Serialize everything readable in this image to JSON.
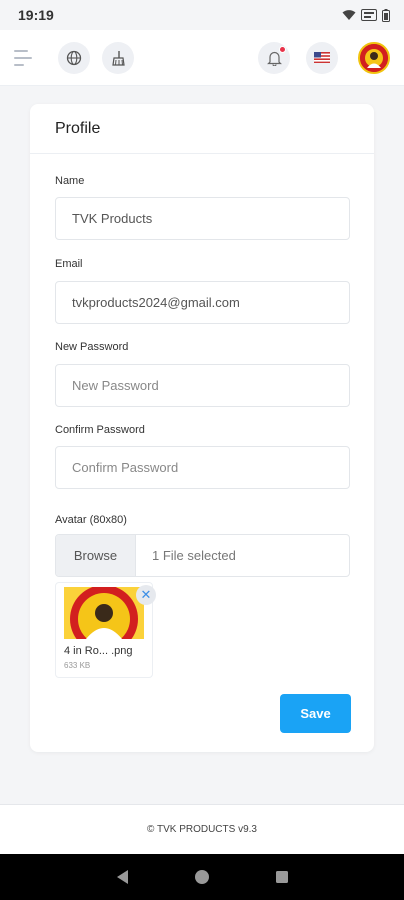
{
  "status_bar": {
    "time": "19:19"
  },
  "topbar": {
    "flag": "🇺🇸"
  },
  "profile": {
    "title": "Profile",
    "fields": {
      "name_label": "Name",
      "name_value": "TVK Products",
      "email_label": "Email",
      "email_value": "tvkproducts2024@gmail.com",
      "new_password_label": "New Password",
      "new_password_placeholder": "New Password",
      "confirm_password_label": "Confirm Password",
      "confirm_password_placeholder": "Confirm Password",
      "avatar_label": "Avatar (80x80)"
    },
    "file_input": {
      "browse_label": "Browse",
      "status": "1 File selected"
    },
    "uploaded_file": {
      "name": "4 in Ro... .png",
      "size": "633 KB"
    },
    "save_label": "Save"
  },
  "footer": {
    "text": "© TVK PRODUCTS v9.3"
  },
  "colors": {
    "accent": "#1aa3f5",
    "notification": "#e8334a"
  }
}
